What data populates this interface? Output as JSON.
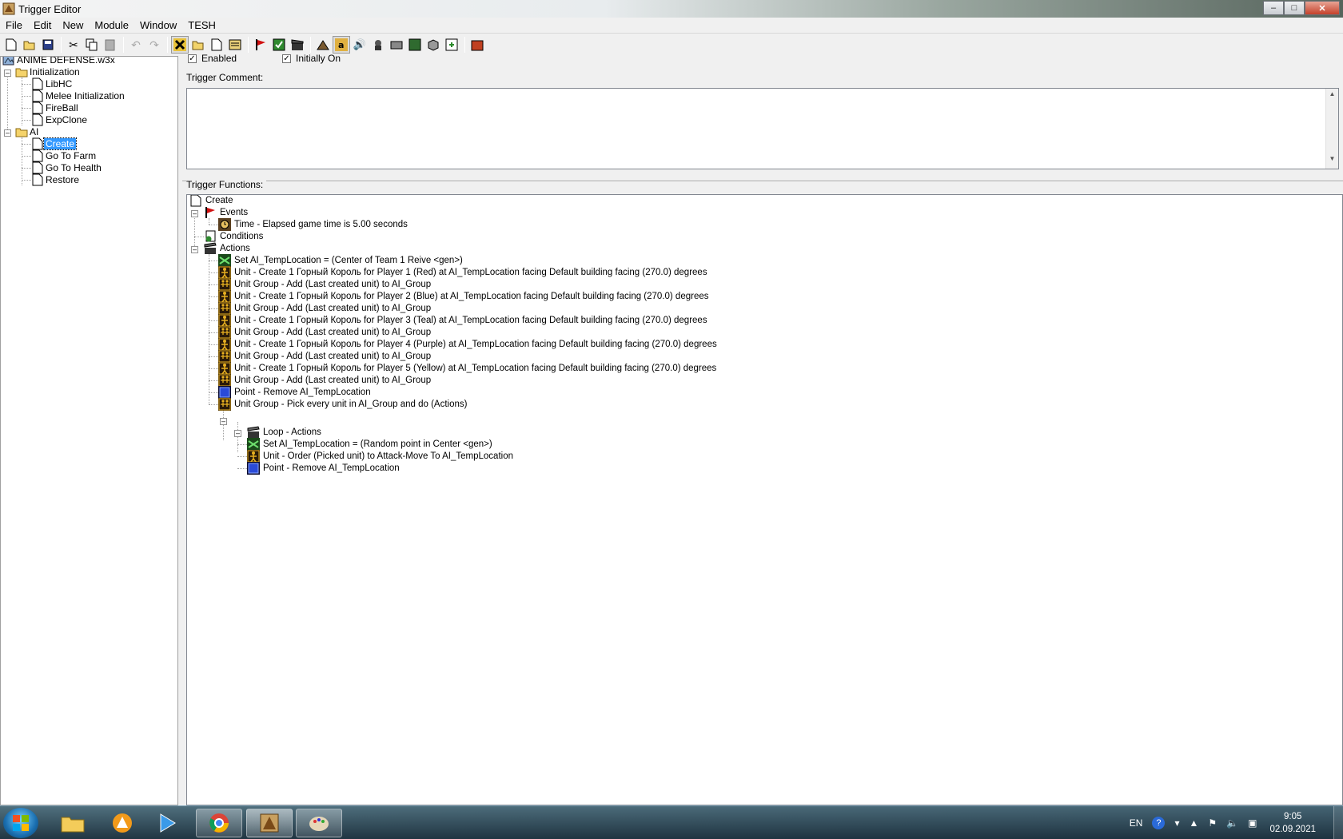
{
  "window": {
    "title": "Trigger Editor"
  },
  "menu": [
    "File",
    "Edit",
    "New",
    "Module",
    "Window",
    "TESH"
  ],
  "tree": {
    "root": "ANIME DEFENSE.w3x",
    "items": [
      {
        "label": "Initialization",
        "kind": "folder",
        "level": 1,
        "expanded": true
      },
      {
        "label": "LibHC",
        "kind": "trigger",
        "level": 2
      },
      {
        "label": "Melee Initialization",
        "kind": "trigger",
        "level": 2
      },
      {
        "label": "FireBall",
        "kind": "trigger",
        "level": 2
      },
      {
        "label": "ExpClone",
        "kind": "trigger",
        "level": 2
      },
      {
        "label": "AI",
        "kind": "folder",
        "level": 1,
        "expanded": true
      },
      {
        "label": "Create",
        "kind": "trigger",
        "level": 2,
        "selected": true
      },
      {
        "label": "Go To Farm",
        "kind": "trigger",
        "level": 2
      },
      {
        "label": "Go To Health",
        "kind": "trigger",
        "level": 2
      },
      {
        "label": "Restore",
        "kind": "trigger",
        "level": 2
      }
    ]
  },
  "trigger": {
    "enabled_label": "Enabled",
    "enabled": true,
    "initially_on_label": "Initially On",
    "initially_on": true,
    "comment_label": "Trigger Comment:",
    "comment": "",
    "functions_label": "Trigger Functions:"
  },
  "functions": {
    "name": "Create",
    "events_label": "Events",
    "events": [
      "Time - Elapsed game time is 5.00 seconds"
    ],
    "conditions_label": "Conditions",
    "actions_label": "Actions",
    "actions": [
      {
        "icon": "variable",
        "text": "Set AI_TempLocation = (Center of Team 1 Reive <gen>)"
      },
      {
        "icon": "unit",
        "text": "Unit - Create 1 Горный Король for Player 1 (Red) at AI_TempLocation facing Default building facing (270.0) degrees"
      },
      {
        "icon": "unitgroup",
        "text": "Unit Group - Add (Last created unit) to AI_Group"
      },
      {
        "icon": "unit",
        "text": "Unit - Create 1 Горный Король for Player 2 (Blue) at AI_TempLocation facing Default building facing (270.0) degrees"
      },
      {
        "icon": "unitgroup",
        "text": "Unit Group - Add (Last created unit) to AI_Group"
      },
      {
        "icon": "unit",
        "text": "Unit - Create 1 Горный Король for Player 3 (Teal) at AI_TempLocation facing Default building facing (270.0) degrees"
      },
      {
        "icon": "unitgroup",
        "text": "Unit Group - Add (Last created unit) to AI_Group"
      },
      {
        "icon": "unit",
        "text": "Unit - Create 1 Горный Король for Player 4 (Purple) at AI_TempLocation facing Default building facing (270.0) degrees"
      },
      {
        "icon": "unitgroup",
        "text": "Unit Group - Add (Last created unit) to AI_Group"
      },
      {
        "icon": "unit",
        "text": "Unit - Create 1 Горный Король for Player 5 (Yellow) at AI_TempLocation facing Default building facing (270.0) degrees"
      },
      {
        "icon": "unitgroup",
        "text": "Unit Group - Add (Last created unit) to AI_Group"
      },
      {
        "icon": "point",
        "text": "Point - Remove AI_TempLocation"
      },
      {
        "icon": "unitgroup",
        "text": "Unit Group - Pick every unit in AI_Group and do (Actions)"
      }
    ],
    "loop_label": "Loop - Actions",
    "loop_actions": [
      {
        "icon": "variable",
        "text": "Set AI_TempLocation = (Random point in Center <gen>)"
      },
      {
        "icon": "unit",
        "text": "Unit - Order (Picked unit) to Attack-Move To AI_TempLocation"
      },
      {
        "icon": "point",
        "text": "Point - Remove AI_TempLocation"
      }
    ]
  },
  "taskbar": {
    "apps": [
      "windows-explorer",
      "aimp",
      "media-player",
      "chrome",
      "world-editor",
      "paint"
    ],
    "active_app": "world-editor",
    "language": "EN",
    "time": "9:05",
    "date": "02.09.2021"
  },
  "colors": {
    "selection": "#3399ff",
    "chrome_bg": "#f0f0f0"
  }
}
